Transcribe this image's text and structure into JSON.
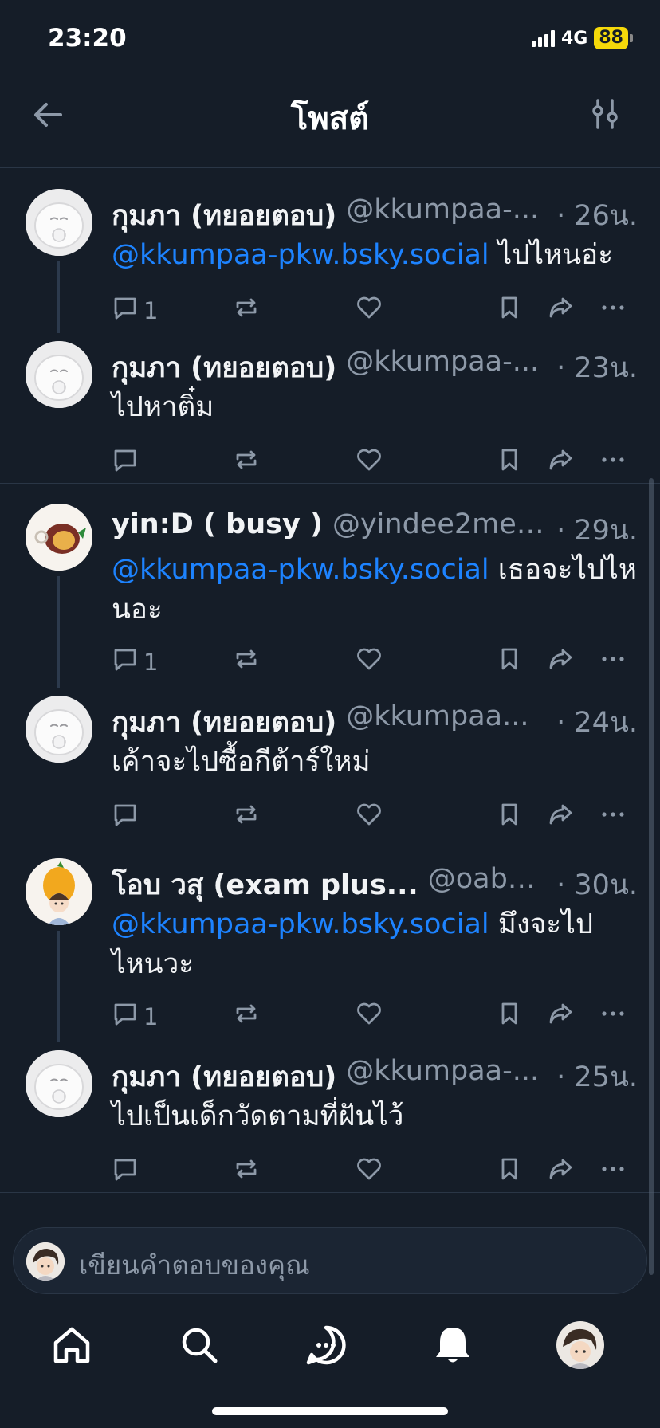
{
  "status_bar": {
    "time": "23:20",
    "network": "4G",
    "battery": "88"
  },
  "header": {
    "title": "โพสต์"
  },
  "threads": [
    {
      "posts": [
        {
          "name": "กุมภา (ทยอยตอบ)",
          "handle": "@kkumpaa-...",
          "time": "· 26น.",
          "mention": "@kkumpaa-pkw.bsky.social",
          "text": " ไปไหนอ่ะ",
          "replies": "1"
        },
        {
          "name": "กุมภา (ทยอยตอบ)",
          "handle": "@kkumpaa-...",
          "time": "· 23น.",
          "mention": "",
          "text": "ไปหาติ๋ม",
          "replies": ""
        }
      ]
    },
    {
      "posts": [
        {
          "name": "yin:D ( busy )",
          "handle": "@yindee2meet...",
          "time": "· 29น.",
          "mention": "@kkumpaa-pkw.bsky.social",
          "text": " เธอจะไปไหนอะ",
          "replies": "1"
        },
        {
          "name": "กุมภา (ทยอยตอบ)",
          "handle": "@kkumpaa...",
          "time": "· 24น.",
          "mention": "",
          "text": "เค้าจะไปซื้อกีต้าร์ใหม่",
          "replies": ""
        }
      ]
    },
    {
      "posts": [
        {
          "name": "โอบ วสุ (exam plus...",
          "handle": "@oabao...",
          "time": "· 30น.",
          "mention": "@kkumpaa-pkw.bsky.social",
          "text": " มึงจะไปไหนวะ",
          "replies": "1"
        },
        {
          "name": "กุมภา (ทยอยตอบ)",
          "handle": "@kkumpaa-...",
          "time": "· 25น.",
          "mention": "",
          "text": "ไปเป็นเด็กวัดตามที่ฝันไว้",
          "replies": ""
        }
      ]
    }
  ],
  "composer": {
    "placeholder": "เขียนคำตอบของคุณ"
  },
  "tabs": [
    "home-tab",
    "search-tab",
    "chat-tab",
    "notifications-tab",
    "profile-tab"
  ],
  "colors": {
    "background": "#151d28",
    "mention": "#1d83ff",
    "muted": "#8d99a8",
    "battery": "#f5d90a"
  }
}
